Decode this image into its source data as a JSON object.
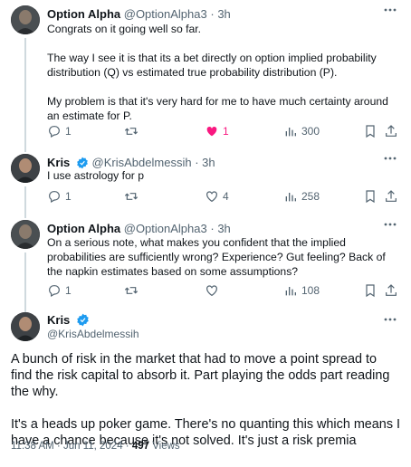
{
  "tweets": [
    {
      "name": "Option Alpha",
      "handle": "@OptionAlpha3",
      "dot": "·",
      "time": "3h",
      "paragraphs": [
        "Congrats on it going well so far.",
        "The way I see it is that its a bet directly on option implied probability distribution (Q) vs estimated true probability distribution (P).",
        "My problem is that it's very hard for me to have much certainty around an estimate for P."
      ],
      "replies": "1",
      "retweets": "",
      "likes": "1",
      "views": "300"
    },
    {
      "name": "Kris",
      "handle": "@KrisAbdelmessih",
      "dot": "·",
      "time": "3h",
      "paragraphs": [
        "I use astrology for p"
      ],
      "replies": "1",
      "retweets": "",
      "likes": "4",
      "views": "258"
    },
    {
      "name": "Option Alpha",
      "handle": "@OptionAlpha3",
      "dot": "·",
      "time": "3h",
      "paragraphs": [
        "On a serious note, what makes you confident that the implied probabilities are sufficiently wrong? Experience? Gut feeling? Back of the napkin estimates based on some assumptions?"
      ],
      "replies": "1",
      "retweets": "",
      "likes": "",
      "views": "108"
    }
  ],
  "main_tweet": {
    "name": "Kris",
    "handle": "@KrisAbdelmessih",
    "paragraphs": [
      "A bunch of risk in the market that had to move a point spread to find the risk capital to absorb it. Part playing the odds part reading the why.",
      "It's a heads up poker game. There's no quanting this which means I have a chance because it's not solved. It's just a risk premia"
    ],
    "timestamp": "11:38 AM · Jun 11, 2024 · ",
    "views_count": "497",
    "views_label": " Views"
  },
  "colors": {
    "like_active": "#f91880",
    "verified": "#1d9bf0",
    "muted": "#536471"
  },
  "icons": [
    "more-icon",
    "reply-icon",
    "retweet-icon",
    "like-icon",
    "views-icon",
    "bookmark-icon",
    "share-icon",
    "verified-badge-icon"
  ]
}
